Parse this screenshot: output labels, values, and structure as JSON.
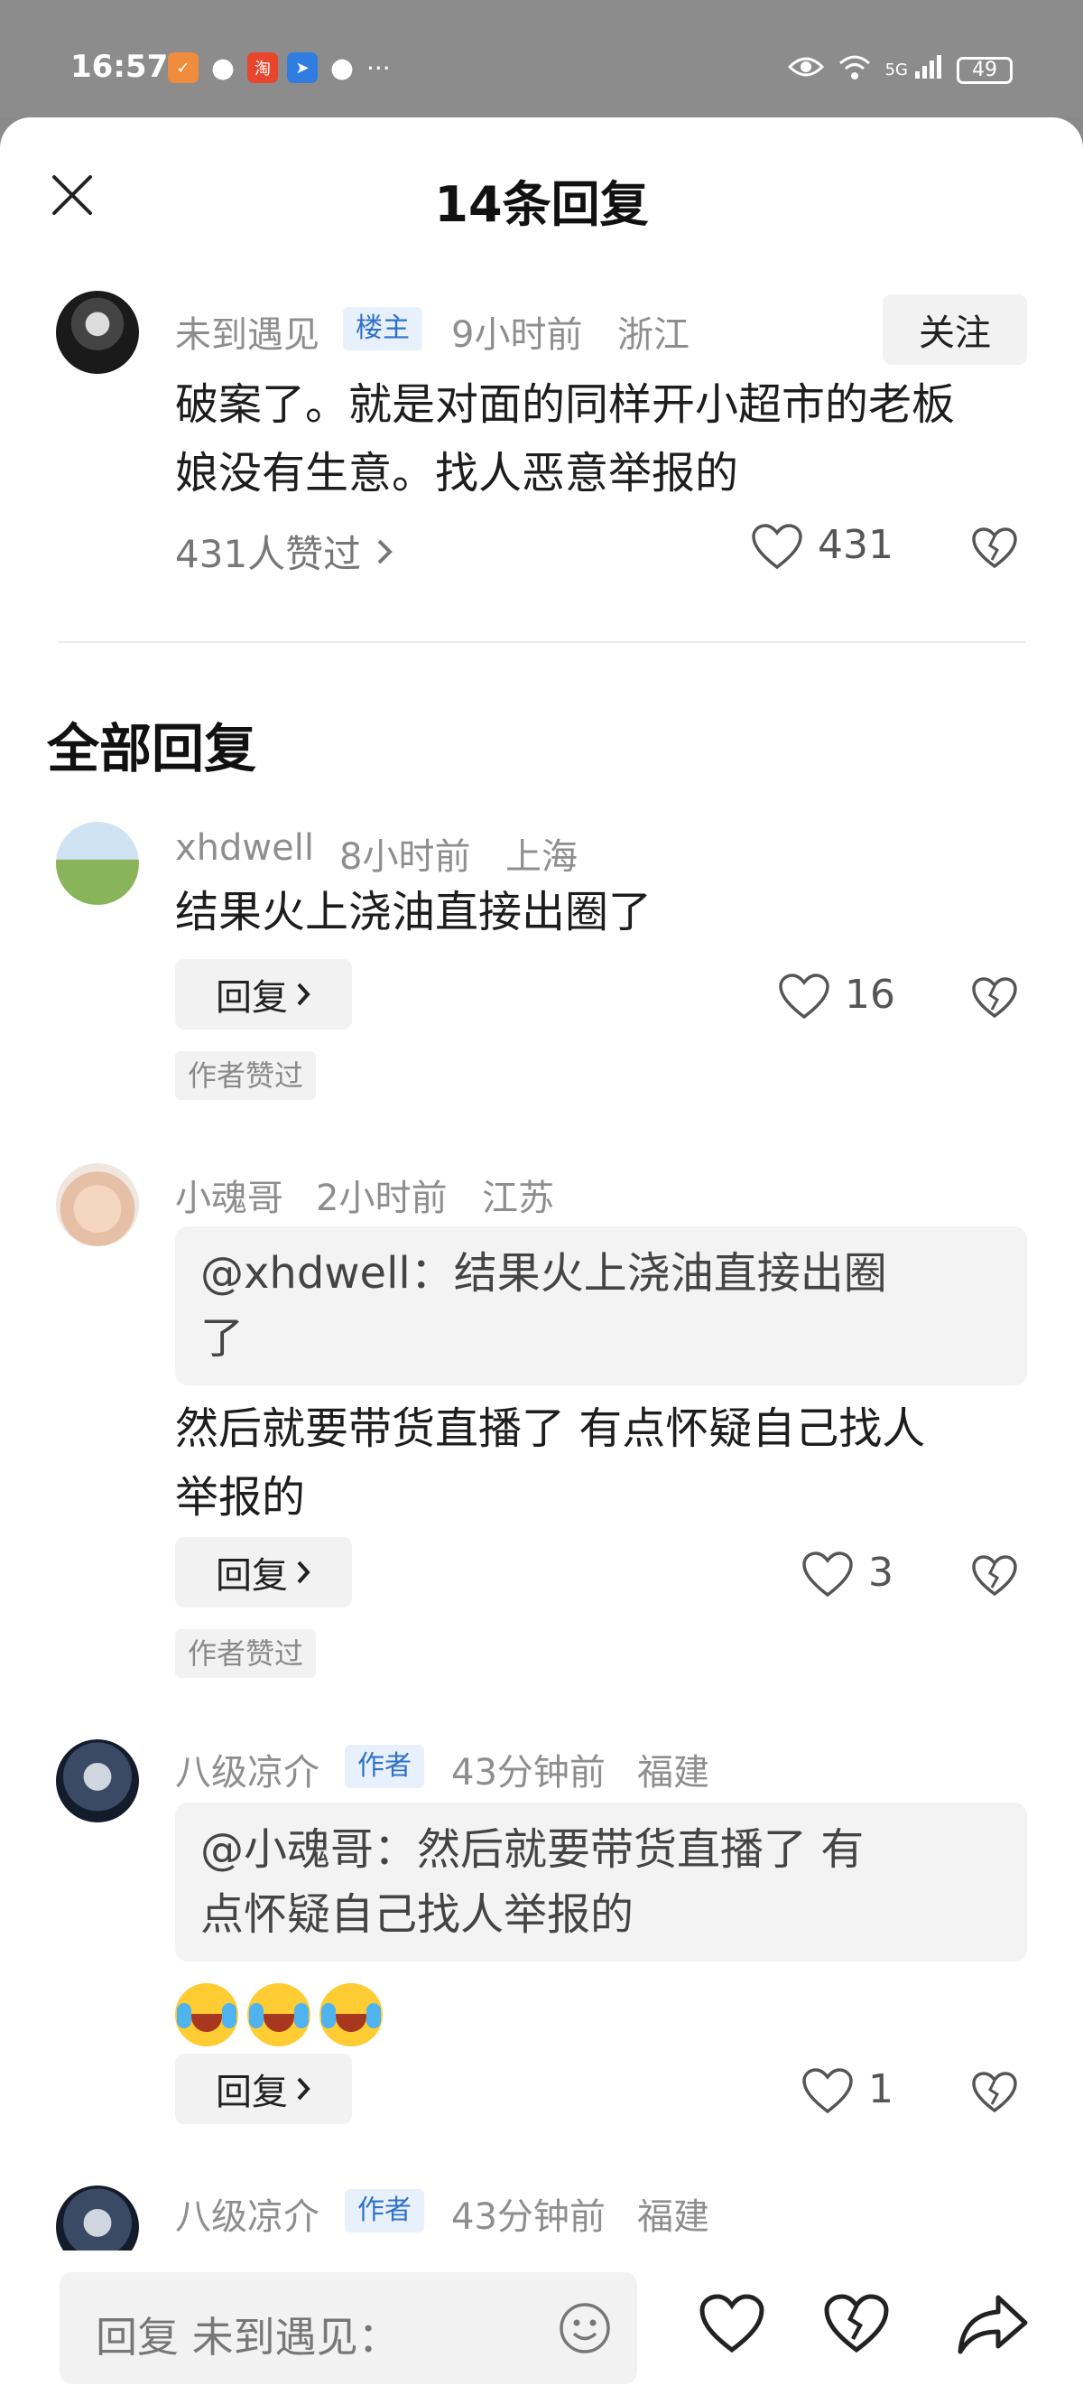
{
  "status_bar": {
    "time": "16:57",
    "battery": "49",
    "signal_label": "5G",
    "dots": "···"
  },
  "title": "14条回复",
  "main_comment": {
    "username": "未到遇见",
    "badge": "楼主",
    "time": "9小时前",
    "location": "浙江",
    "follow_label": "关注",
    "text_line1": "破案了。就是对面的同样开小超市的老板",
    "text_line2": "娘没有生意。找人恶意举报的",
    "liked_by": "431人赞过",
    "likes": "431"
  },
  "section_title": "全部回复",
  "replies": [
    {
      "username": "xhdwell",
      "time": "8小时前",
      "location": "上海",
      "text": "结果火上浇油直接出圈了",
      "reply_label": "回复",
      "likes": "16",
      "author_liked": "作者赞过"
    },
    {
      "username": "小魂哥",
      "time": "2小时前",
      "location": "江苏",
      "quote_line1": "@xhdwell：结果火上浇油直接出圈",
      "quote_line2": "了",
      "text_line1": "然后就要带货直播了 有点怀疑自己找人",
      "text_line2": "举报的",
      "reply_label": "回复",
      "likes": "3",
      "author_liked": "作者赞过"
    },
    {
      "username": "八级凉介",
      "badge": "作者",
      "time": "43分钟前",
      "location": "福建",
      "quote_line1": "@小魂哥：然后就要带货直播了 有",
      "quote_line2": "点怀疑自己找人举报的",
      "reply_label": "回复",
      "likes": "1"
    },
    {
      "username": "八级凉介",
      "badge": "作者",
      "time": "43分钟前",
      "location": "福建"
    }
  ],
  "bottom_bar": {
    "placeholder": "回复 未到遇见："
  },
  "colors": {
    "badge_blue": "#2f72c8",
    "badge_bg": "#e8f1fb",
    "gray_text": "#8e8e8e"
  }
}
